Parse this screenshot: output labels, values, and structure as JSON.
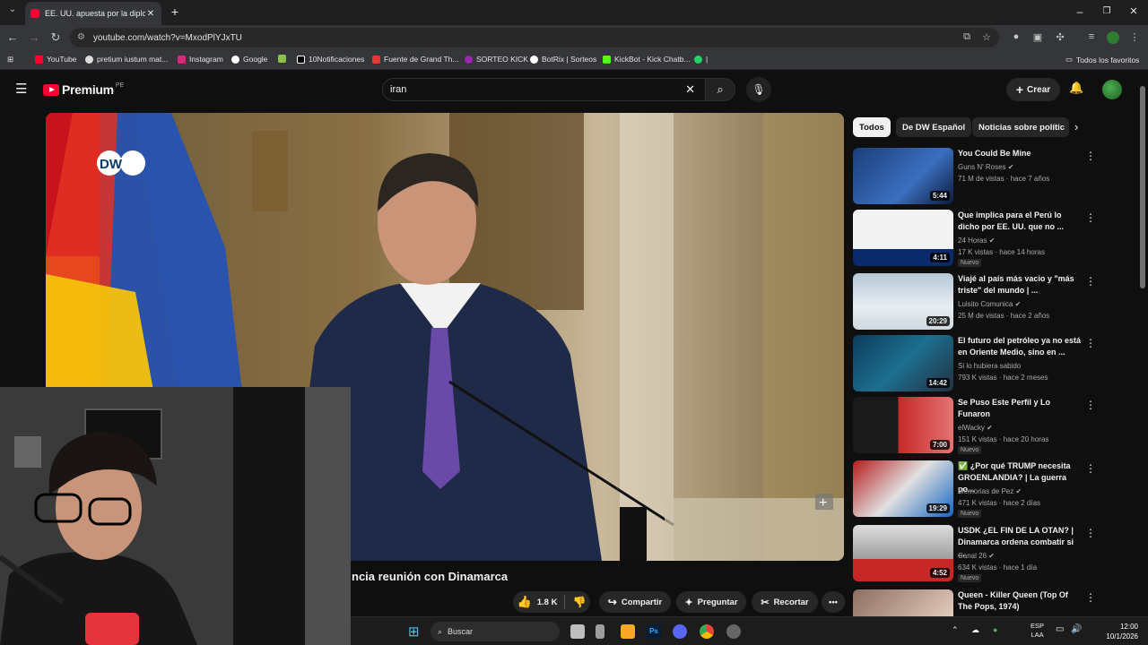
{
  "browser": {
    "tab_title": "EE. UU. apuesta por la diplomac",
    "url": "youtube.com/watch?v=MxodPlYJxTU",
    "bookmarks": [
      "YouTube",
      "pretium iustum mat...",
      "Instagram",
      "Google",
      "10Notificaciones",
      "Fuente de Grand Th...",
      "SORTEO KICK",
      "BotRix | Sorteos",
      "KickBot - Kick Chatb..."
    ],
    "all_bookmarks": "Todos los favoritos"
  },
  "youtube": {
    "logo_text": "Premium",
    "logo_region": "PE",
    "search_value": "iran",
    "create_label": "Crear"
  },
  "video": {
    "channel_logo": "DW",
    "title_partial": "ncia reunión con Dinamarca",
    "likes": "1.8 K",
    "share_label": "Compartir",
    "ask_label": "Preguntar",
    "clip_label": "Recortar"
  },
  "chips": [
    "Todos",
    "De DW Español",
    "Noticias sobre polític"
  ],
  "recommendations": [
    {
      "title": "You Could Be Mine",
      "channel": "Guns N' Roses",
      "meta": "71 M de vistas · hace 7 años",
      "duration": "5:44",
      "new": false
    },
    {
      "title": "Que implica para el Perú lo dicho por EE. UU. que no ...",
      "channel": "24 Horas",
      "meta": "17 K vistas · hace 14 horas",
      "duration": "4:11",
      "new": true
    },
    {
      "title": "Viajé al país más vacio y \"más triste\" del mundo | ...",
      "channel": "Luisito Comunica",
      "meta": "25 M de vistas · hace 2 años",
      "duration": "20:29",
      "new": false
    },
    {
      "title": "El futuro del petróleo ya no está en Oriente Medio, sino en ...",
      "channel": "Si lo hubiera sabido",
      "meta": "793 K vistas · hace 2 meses",
      "duration": "14:42",
      "new": false
    },
    {
      "title": "Se Puso Este Perfil y Lo Funaron",
      "channel": "elWacky",
      "meta": "151 K vistas · hace 20 horas",
      "duration": "7:00",
      "new": true
    },
    {
      "title": "✅ ¿Por qué TRUMP necesita GROENLANDIA? | La guerra po...",
      "channel": "Memorias de Pez",
      "meta": "471 K vistas · hace 2 días",
      "duration": "19:29",
      "new": true
    },
    {
      "title": "USDK ¿EL FIN DE LA OTAN? | Dinamarca ordena combatir si ...",
      "channel": "Canal 26",
      "meta": "634 K vistas · hace 1 día",
      "duration": "4:52",
      "new": true
    },
    {
      "title": "Queen - Killer Queen (Top Of The Pops, 1974)",
      "channel": "",
      "meta": "",
      "duration": "",
      "new": false
    }
  ],
  "new_badge": "Nuevo",
  "taskbar": {
    "search_label": "Buscar",
    "lang_top": "ESP",
    "lang_bottom": "LAA",
    "time": "12:00",
    "date": "10/1/2026"
  },
  "colors": {
    "brand": "#ff0033",
    "bg": "#0f0f0f",
    "chip": "#272727"
  }
}
